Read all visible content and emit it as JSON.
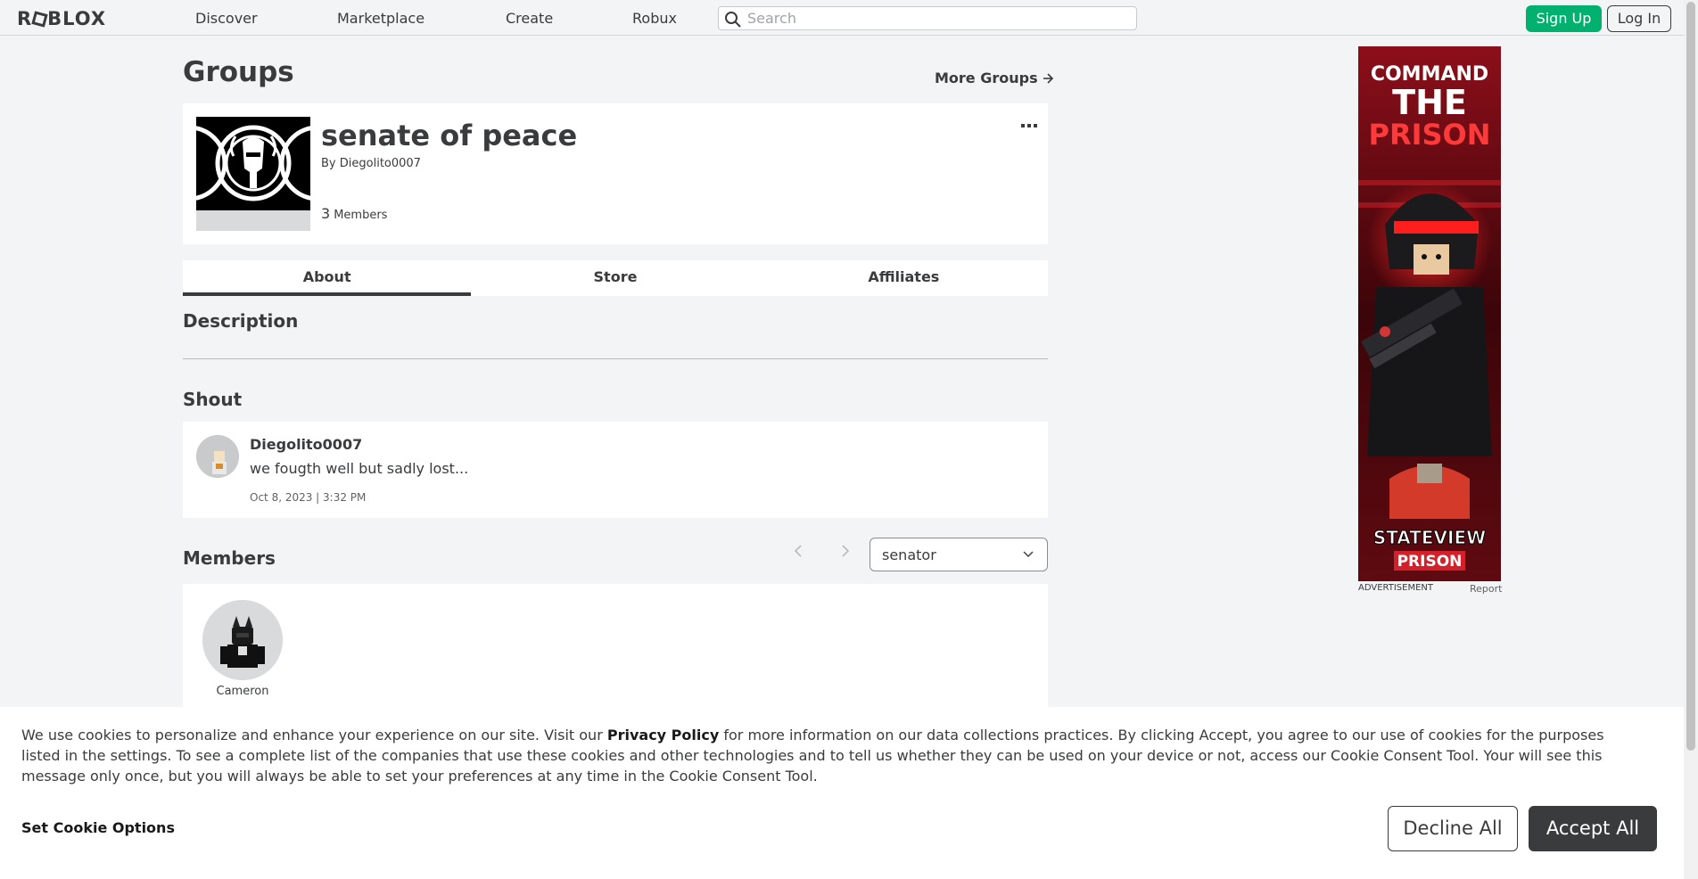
{
  "header": {
    "logo": "ROBLOX",
    "nav": [
      "Discover",
      "Marketplace",
      "Create",
      "Robux"
    ],
    "search_placeholder": "Search",
    "signup_label": "Sign Up",
    "login_label": "Log In"
  },
  "page": {
    "title": "Groups",
    "more_groups": "More Groups"
  },
  "group": {
    "name": "senate of peace",
    "by_label": "By",
    "owner": "Diegolito0007",
    "member_count": "3",
    "members_label": "Members"
  },
  "tabs": [
    "About",
    "Store",
    "Affiliates"
  ],
  "sections": {
    "description": "Description",
    "shout": "Shout",
    "members": "Members"
  },
  "shout": {
    "user": "Diegolito0007",
    "text": "we fougth well but sadly lost...",
    "date": "Oct 8, 2023 | 3:32 PM"
  },
  "members_panel": {
    "rank_selected": "senator",
    "items": [
      {
        "name": "Cameron"
      }
    ]
  },
  "ad": {
    "headline_1": "COMMAND",
    "headline_2": "THE",
    "headline_3": "PRISON",
    "brand_1": "STATEVIEW",
    "brand_2": "PRISON",
    "label": "ADVERTISEMENT",
    "report": "Report"
  },
  "cookie": {
    "text_before": "We use cookies to personalize and enhance your experience on our site. Visit our ",
    "link": "Privacy Policy",
    "text_after": " for more information on our data collections practices. By clicking Accept, you agree to our use of cookies for the purposes listed in the settings. To see a complete list of the companies that use these cookies and other technologies and to tell us whether they can be used on your device or not, access our Cookie Consent Tool. Your will see this message only once, but you will always be able to set your preferences at any time in the Cookie Consent Tool.",
    "options": "Set Cookie Options",
    "decline": "Decline All",
    "accept": "Accept All"
  },
  "colors": {
    "signup_green": "#00b06f",
    "text_dark": "#393b3d",
    "background": "#f2f4f5"
  }
}
